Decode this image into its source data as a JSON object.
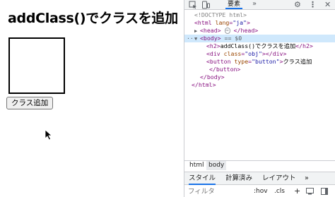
{
  "page": {
    "title": "addClass()でクラスを追加",
    "button_label": "クラス追加"
  },
  "devtools": {
    "toolbar": {
      "elements_tab": "要素",
      "more": "»"
    },
    "dom": {
      "doctype": "<!DOCTYPE html>",
      "html_open_tag": "<html",
      "html_lang_attr": "lang",
      "html_lang_val": "\"ja\"",
      "head_open": "<head>",
      "head_close": "</head>",
      "body_open": "<body>",
      "body_marker": "== $0",
      "h2_open": "<h2>",
      "h2_text": "addClass()でクラスを追加",
      "h2_close": "</h2>",
      "div_open": "<div",
      "div_attr": "class",
      "div_val": "\"obj\"",
      "div_close": "></div>",
      "button_open": "<button",
      "button_attr": "type",
      "button_val": "\"button\"",
      "button_text": "クラス追加",
      "button_close": "</button>",
      "body_close": "</body>",
      "html_close": "</html>"
    },
    "breadcrumbs": [
      "html",
      "body"
    ],
    "subtabs": [
      "スタイル",
      "計算済み",
      "レイアウト",
      "»"
    ],
    "filter": {
      "placeholder": "フィルタ",
      "hov": ":hov",
      "cls": ".cls",
      "plus": "+"
    }
  }
}
